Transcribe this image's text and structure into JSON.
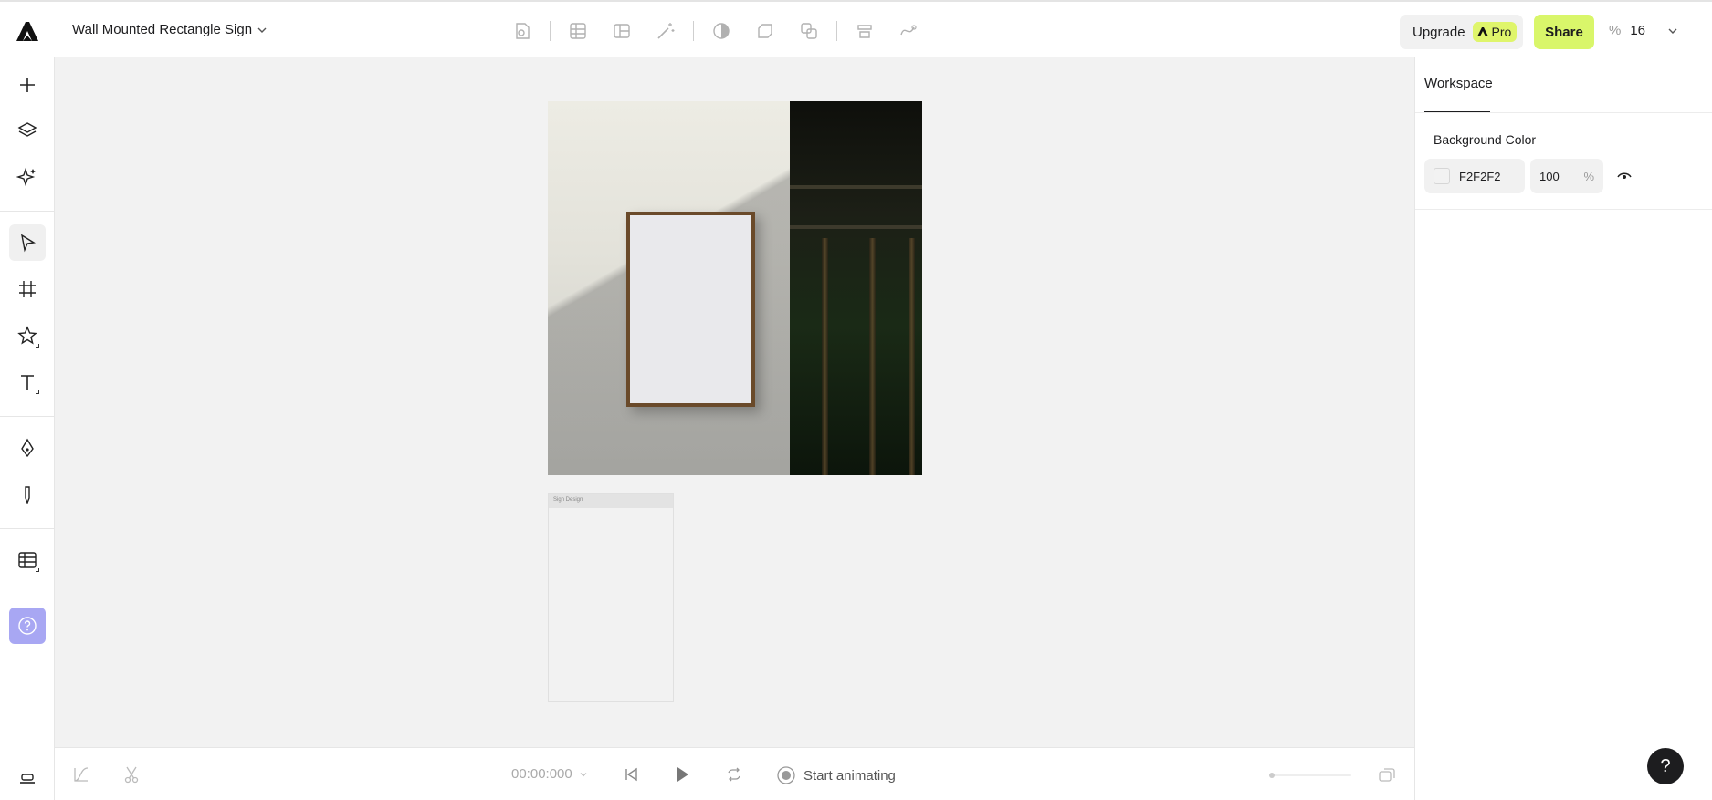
{
  "header": {
    "document_title": "Wall Mounted Rectangle Sign",
    "upgrade_label": "Upgrade",
    "pro_label": "Pro",
    "share_label": "Share",
    "zoom_symbol": "%",
    "zoom_value": "16",
    "center_tools": [
      "image-replace-icon",
      "grid-icon",
      "mockup-icon",
      "magic-wand-icon",
      "contrast-icon",
      "shape-icon",
      "boolean-icon",
      "warp-icon",
      "path-icon"
    ]
  },
  "left_toolbar": {
    "tools": [
      "plus-icon",
      "layers-icon",
      "ai-sparkle-icon",
      "select-arrow-icon",
      "frame-icon",
      "star-icon",
      "text-icon",
      "pen-icon",
      "pencil-icon",
      "table-icon",
      "help-icon",
      "align-bottom-icon"
    ],
    "active_tool": "select-arrow-icon"
  },
  "canvas": {
    "layer_panel_title": "Sign Design"
  },
  "timeline": {
    "timecode": "00:00:000",
    "start_animating_label": "Start animating",
    "slider_value": 0
  },
  "right_panel": {
    "tab_label": "Workspace",
    "background_color_label": "Background Color",
    "background_color_hex": "F2F2F2",
    "opacity_value": "100",
    "opacity_unit": "%"
  },
  "help_fab_label": "?",
  "colors": {
    "accent": "#d9f66a",
    "help_button": "#a8a7f3",
    "canvas_bg": "#f2f2f2"
  }
}
